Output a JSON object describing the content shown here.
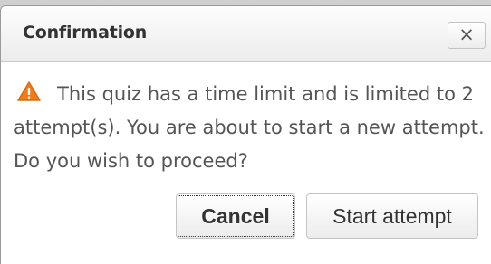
{
  "dialog": {
    "title": "Confirmation",
    "close_label": "×",
    "message": "This quiz has a time limit and is limited to 2 attempt(s). You are about to start a new attempt. Do you wish to proceed?",
    "icon": "warning-icon",
    "warning_color": "#f07c1a"
  },
  "buttons": {
    "cancel_label": "Cancel",
    "start_label": "Start attempt"
  }
}
